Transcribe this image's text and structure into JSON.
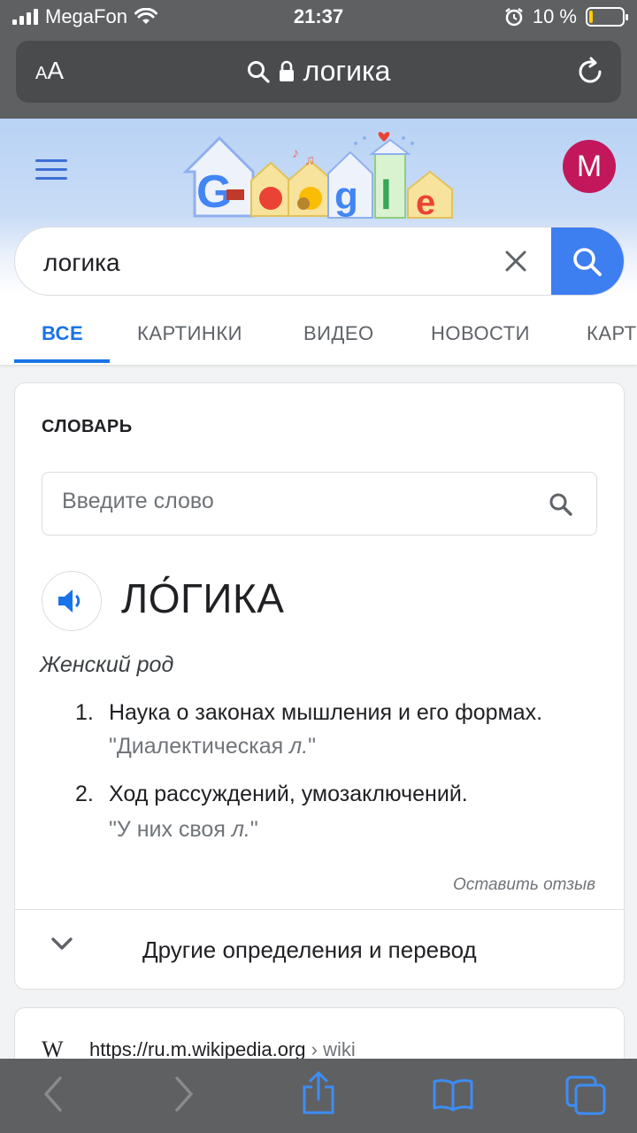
{
  "status": {
    "carrier": "MegaFon",
    "time": "21:37",
    "battery": "10 %",
    "battery_level": 0.1
  },
  "browser": {
    "text_size_label": "AA",
    "url_text": "логика"
  },
  "google": {
    "avatar_letter": "M",
    "search_query": "логика",
    "tabs": [
      "ВСЕ",
      "КАРТИНКИ",
      "ВИДЕО",
      "НОВОСТИ",
      "КАРТ"
    ],
    "active_tab": "ВСЕ"
  },
  "dictionary": {
    "title": "СЛОВАРЬ",
    "input_placeholder": "Введите слово",
    "headword": "ЛО́ГИКА",
    "part_of_speech": "Женский род",
    "definitions": [
      {
        "num": "1.",
        "text": "Наука о законах мышления и его формах.",
        "example_quote_open": "\"Диалектическая ",
        "example_italic": "л.",
        "example_quote_close": "\""
      },
      {
        "num": "2.",
        "text": "Ход рассуждений, умозаключений.",
        "example_quote_open": "\"У них своя ",
        "example_italic": "л.",
        "example_quote_close": "\""
      }
    ],
    "feedback": "Оставить отзыв",
    "more_label": "Другие определения и перевод"
  },
  "result": {
    "wiki_logo": "W",
    "url": "https://ru.m.wikipedia.org",
    "crumb": " › wiki"
  },
  "colors": {
    "google_blue": "#1a73e8",
    "search_button": "#3d7ef0",
    "avatar": "#c2185b",
    "ios_blue": "#1a73e8"
  }
}
